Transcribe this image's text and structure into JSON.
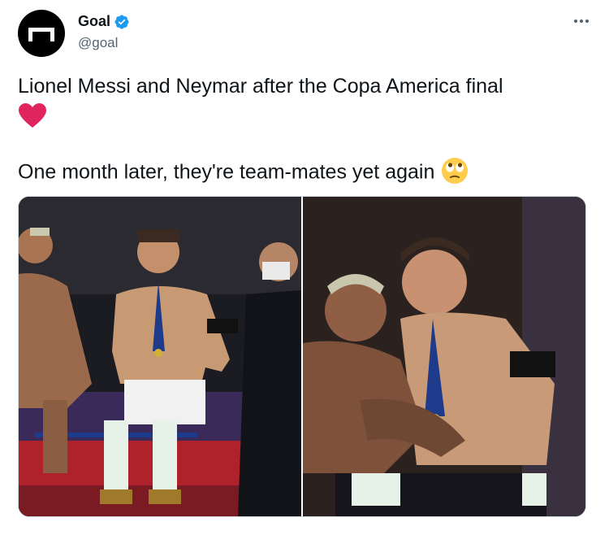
{
  "author": {
    "display_name": "Goal",
    "handle": "@goal",
    "verified": true,
    "avatar_icon": "goal-logo-icon"
  },
  "tweet": {
    "line1": "Lionel Messi and Neymar after the Copa America final",
    "line1_emoji": "heart-emoji",
    "line2": "One month later, they're team-mates yet again",
    "line2_emoji": "face-with-rolling-eyes-emoji"
  },
  "media": {
    "count": 2,
    "photos": [
      {
        "name": "photo-messi-neymar-seated-stairs"
      },
      {
        "name": "photo-neymar-leaning-on-messi"
      }
    ]
  },
  "colors": {
    "verified_blue": "#1d9bf0",
    "heart_red": "#e0245e",
    "secondary_text": "#536471"
  }
}
